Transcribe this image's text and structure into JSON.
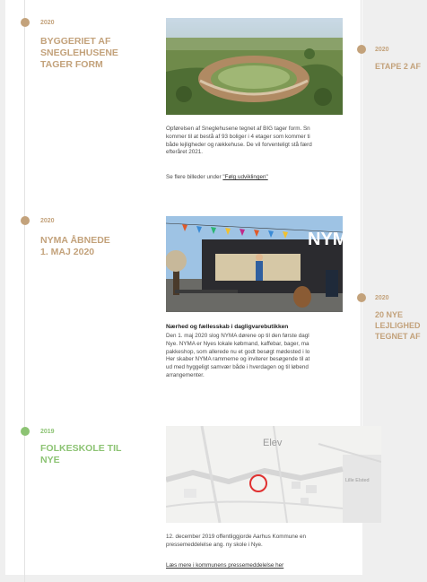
{
  "colors": {
    "gold": "#c3a27b",
    "green": "#8cc373"
  },
  "left_column": {
    "entries": [
      {
        "year": "2020",
        "title": "BYGGERIET AF\nSNEGLEHUSENE\nTAGER FORM",
        "image_alt": "Aerial render of curved residential building",
        "text": "Opførelsen af Sneglehusene tegnet af BIG tager form. Sn\nkommer til at bestå af 93 boliger i 4 etager som kommer ti\nbåde lejligheder og rækkehuse. De vil forventeligt stå færd\nefteråret 2021.",
        "link_prefix": "Se flere billeder under ",
        "link_label": "\"Følg udviklingen\""
      },
      {
        "year": "2020",
        "title": "NYMA ÅBNEDE\n1. MAJ 2020",
        "image_sign": "NYMA",
        "text_title": "Nærhed og fællesskab i dagligvarebutikken",
        "text": "Den 1. maj 2020 slog NYMA dørene op til den første dagl\nNye. NYMA er Nyes lokale købmand, kaffebar, bager, ma\npakkeshop, som allerede nu et godt besøgt mødested i lo\nHer skaber NYMA rammerne og inviterer besøgende til at\nud med hyggeligt samvær både i hverdagen og til løbend\narrangementer."
      },
      {
        "year": "2019",
        "title": "FOLKESKOLE TIL\nNYE",
        "map_label_main": "Elev",
        "map_label_side": "Lille Elsted",
        "text": "12. december 2019 offentliggjorde Aarhus Kommune en\npressemeddelelse ang. ny skole i Nye.",
        "link_label": "Læs mere i kommunens pressemeddelelse her"
      }
    ]
  },
  "right_column": {
    "entries": [
      {
        "year": "2020",
        "title": "ETAPE 2 AF"
      },
      {
        "year": "2020",
        "title": "20 NYE\nLEJLIGHED\nTEGNET AF"
      }
    ]
  }
}
